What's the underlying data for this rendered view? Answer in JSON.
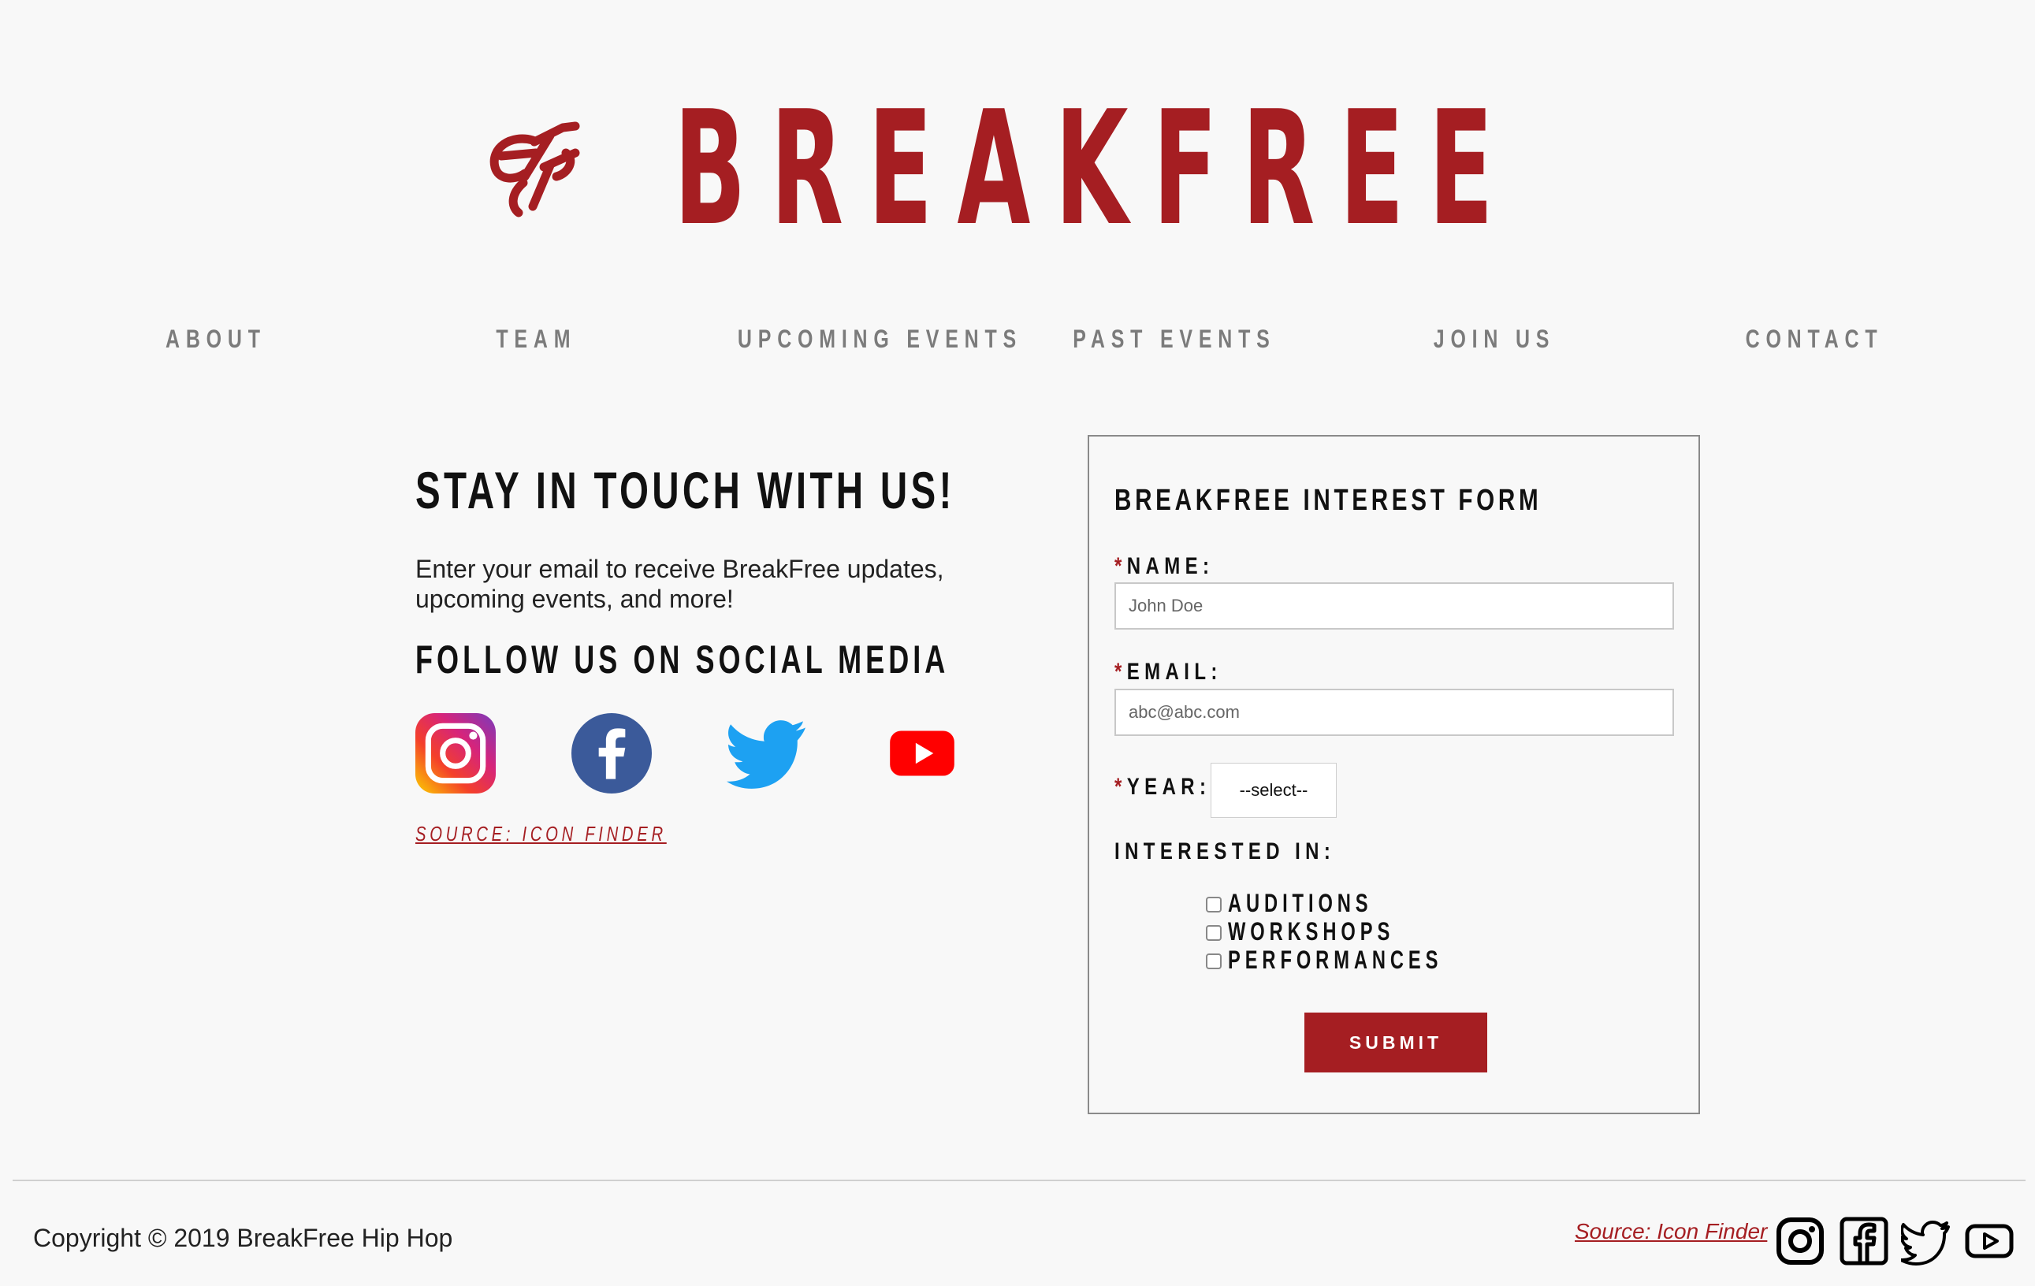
{
  "brand": {
    "name": "BREAKFREE",
    "color": "#a51e22"
  },
  "nav": {
    "items": [
      "ABOUT",
      "TEAM",
      "UPCOMING EVENTS",
      "PAST EVENTS",
      "JOIN US",
      "CONTACT"
    ]
  },
  "newsletter": {
    "heading": "STAY IN TOUCH WITH US!",
    "text_line1": "Enter your email to receive BreakFree updates,",
    "text_line2": "upcoming events, and more!"
  },
  "social": {
    "heading": "FOLLOW US ON SOCIAL MEDIA",
    "icons": [
      "instagram-icon",
      "facebook-icon",
      "twitter-icon",
      "youtube-icon"
    ],
    "source_label": "SOURCE: ICON FINDER"
  },
  "form": {
    "title": "BREAKFREE INTEREST FORM",
    "required_mark": "*",
    "name_label": "NAME:",
    "name_placeholder": "John Doe",
    "email_label": "EMAIL:",
    "email_placeholder": "abc@abc.com",
    "year_label": "YEAR:",
    "year_selected": "--select--",
    "interested_label": "INTERESTED IN:",
    "options": [
      "AUDITIONS",
      "WORKSHOPS",
      "PERFORMANCES"
    ],
    "submit_label": "SUBMIT"
  },
  "footer": {
    "copyright": "Copyright © 2019 BreakFree Hip Hop",
    "source_label": "Source: Icon Finder",
    "icons": [
      "instagram-outline-icon",
      "facebook-outline-icon",
      "twitter-outline-icon",
      "youtube-outline-icon"
    ]
  }
}
